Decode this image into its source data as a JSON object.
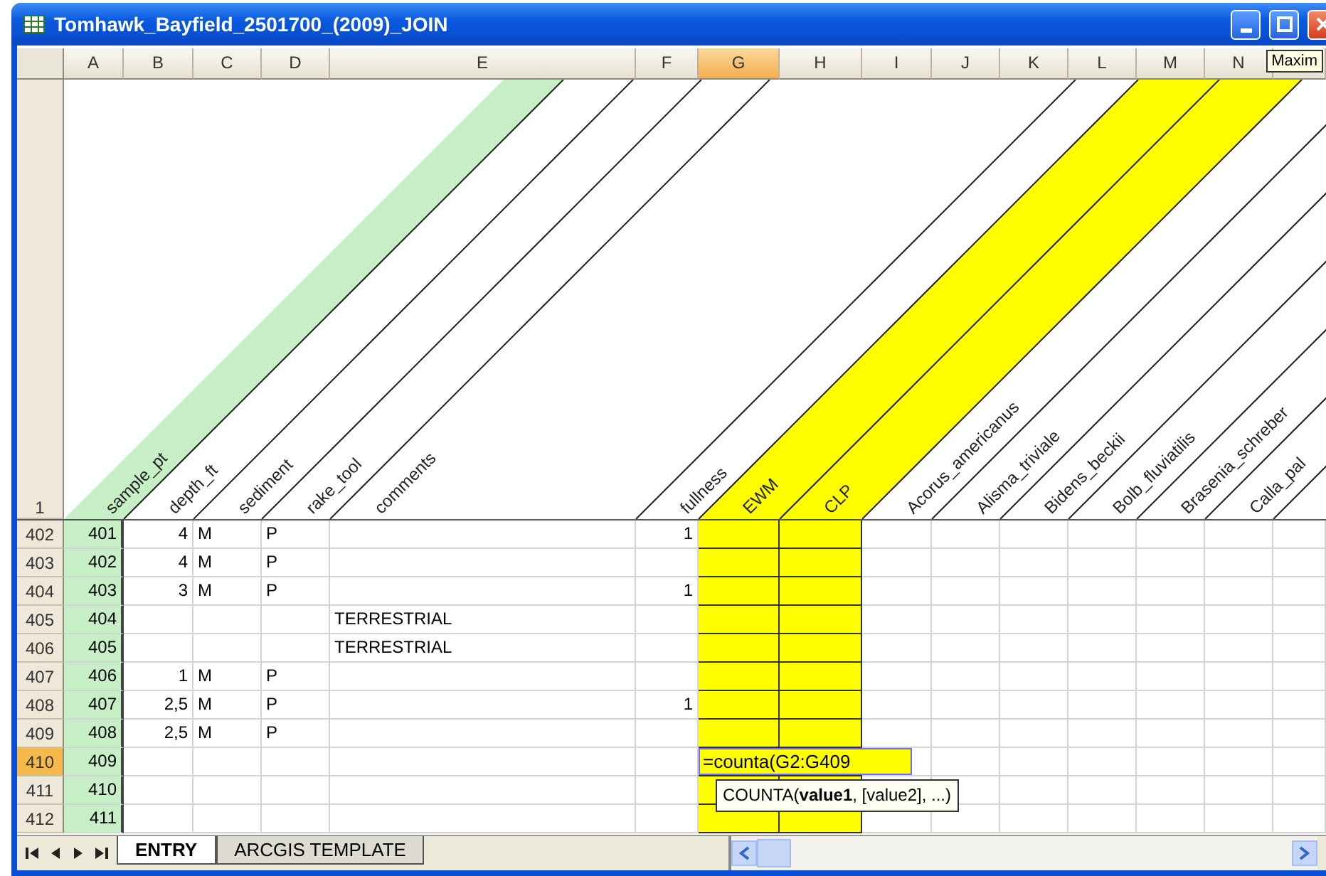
{
  "window": {
    "title": "Tomhawk_Bayfield_2501700_(2009)_JOIN"
  },
  "tooltip": "Maxim",
  "header_row": "1",
  "columns": [
    {
      "letter": "A",
      "label": "sample_pt",
      "selected": false,
      "color": "#c6efc6"
    },
    {
      "letter": "B",
      "label": "depth_ft",
      "selected": false
    },
    {
      "letter": "C",
      "label": "sediment",
      "selected": false
    },
    {
      "letter": "D",
      "label": "rake_tool",
      "selected": false
    },
    {
      "letter": "E",
      "label": "comments",
      "selected": false
    },
    {
      "letter": "F",
      "label": "fullness",
      "selected": false
    },
    {
      "letter": "G",
      "label": "EWM",
      "selected": true,
      "color": "#ffff00"
    },
    {
      "letter": "H",
      "label": "CLP",
      "selected": false,
      "color": "#ffff00"
    },
    {
      "letter": "I",
      "label": "Acorus_americanus",
      "selected": false
    },
    {
      "letter": "J",
      "label": "Alisma_triviale",
      "selected": false
    },
    {
      "letter": "K",
      "label": "Bidens_beckii",
      "selected": false
    },
    {
      "letter": "L",
      "label": "Bolb_fluviatilis",
      "selected": false
    },
    {
      "letter": "M",
      "label": "Brasenia_schreber",
      "selected": false
    },
    {
      "letter": "N",
      "label": "Calla_pal",
      "selected": false
    }
  ],
  "rows": [
    {
      "row": "402",
      "selected": false,
      "cells": [
        "401",
        "4",
        "M",
        "P",
        null,
        "1"
      ]
    },
    {
      "row": "403",
      "selected": false,
      "cells": [
        "402",
        "4",
        "M",
        "P",
        null,
        null
      ]
    },
    {
      "row": "404",
      "selected": false,
      "cells": [
        "403",
        "3",
        "M",
        "P",
        null,
        "1"
      ]
    },
    {
      "row": "405",
      "selected": false,
      "cells": [
        "404",
        null,
        null,
        null,
        "TERRESTRIAL",
        null
      ]
    },
    {
      "row": "406",
      "selected": false,
      "cells": [
        "405",
        null,
        null,
        null,
        "TERRESTRIAL",
        null
      ]
    },
    {
      "row": "407",
      "selected": false,
      "cells": [
        "406",
        "1",
        "M",
        "P",
        null,
        null
      ]
    },
    {
      "row": "408",
      "selected": false,
      "cells": [
        "407",
        "2,5",
        "M",
        "P",
        null,
        "1"
      ]
    },
    {
      "row": "409",
      "selected": false,
      "cells": [
        "408",
        "2,5",
        "M",
        "P",
        null,
        null
      ]
    },
    {
      "row": "410",
      "selected": true,
      "cells": [
        "409",
        null,
        null,
        null,
        null,
        null
      ],
      "formula": "=counta(G2:G409",
      "hint": "COUNTA(**value1**, [value2], ...)"
    },
    {
      "row": "411",
      "selected": false,
      "cells": [
        "410",
        null,
        null,
        null,
        null,
        null
      ]
    },
    {
      "row": "412",
      "selected": false,
      "cells": [
        "411",
        null,
        null,
        null,
        null,
        null
      ]
    }
  ],
  "sheet_tabs": [
    {
      "label": "ENTRY",
      "selected": true
    },
    {
      "label": "ARCGIS TEMPLATE",
      "selected": false
    }
  ]
}
